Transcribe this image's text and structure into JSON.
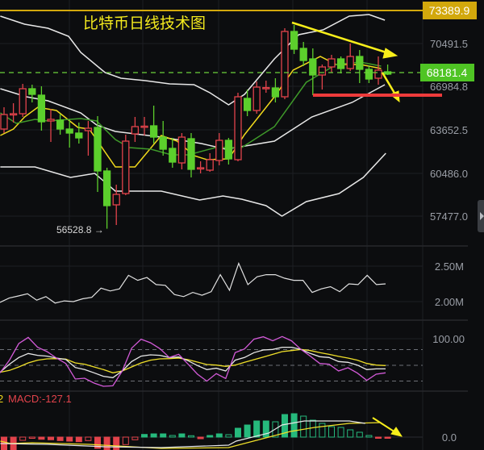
{
  "title": "比特币日线技术图",
  "chart_data": {
    "type": "candlestick",
    "title": "比特币日线技术图",
    "price_axis": {
      "labels": [
        "73389.9",
        "70491.5",
        "68181.4",
        "66984.8",
        "63652.5",
        "60486.0",
        "57477.0"
      ],
      "range": [
        56400,
        73400
      ]
    },
    "last_price": "68181.4",
    "high_line": "73389.9",
    "low_marker": "56528.8",
    "low_marker_arrow": "→",
    "candle_fields": [
      "open",
      "high",
      "low",
      "close"
    ],
    "candles": [
      [
        64043,
        65685,
        63739,
        65138
      ],
      [
        65138,
        65989,
        64530,
        65198
      ],
      [
        65198,
        67448,
        64955,
        67083
      ],
      [
        67083,
        67387,
        66050,
        66658
      ],
      [
        66597,
        67266,
        63922,
        64590
      ],
      [
        64651,
        65563,
        63070,
        64773
      ],
      [
        64712,
        65198,
        63618,
        64043
      ],
      [
        64043,
        64773,
        62645,
        63739
      ],
      [
        63739,
        64530,
        62949,
        63374
      ],
      [
        63922,
        64651,
        62037,
        64104
      ],
      [
        64165,
        65016,
        59301,
        60882
      ],
      [
        60882,
        61125,
        56528.8,
        58267
      ],
      [
        58328,
        59848,
        56808,
        59118
      ],
      [
        59179,
        63618,
        59058,
        63131
      ],
      [
        63678,
        64955,
        63070,
        64226
      ],
      [
        64226,
        64955,
        63557,
        64260
      ],
      [
        64286,
        65807,
        62949,
        63435
      ],
      [
        63435,
        64651,
        62037,
        62523
      ],
      [
        62584,
        63374,
        61125,
        61550
      ],
      [
        61490,
        63739,
        61003,
        63435
      ],
      [
        63314,
        63739,
        60395,
        61003
      ],
      [
        61064,
        61611,
        60699,
        61125
      ],
      [
        60942,
        62219,
        60821,
        61733
      ],
      [
        61672,
        63739,
        61307,
        63192
      ],
      [
        63192,
        63374,
        61368,
        61794
      ],
      [
        61733,
        66779,
        61611,
        66475
      ],
      [
        66354,
        67022,
        65016,
        65442
      ],
      [
        65442,
        67630,
        65200,
        67205
      ],
      [
        67144,
        67691,
        66779,
        67170
      ],
      [
        67144,
        67874,
        66050,
        66475
      ],
      [
        66475,
        71643,
        66293,
        71400
      ],
      [
        71400,
        71887,
        69700,
        70062
      ],
      [
        70123,
        70610,
        68786,
        69211
      ],
      [
        69333,
        70123,
        66597,
        68117
      ],
      [
        68117,
        68907,
        67022,
        68725
      ],
      [
        68725,
        69637,
        68300,
        69333
      ],
      [
        69333,
        69515,
        68239,
        68603
      ],
      [
        68603,
        70489,
        68421,
        69515
      ],
      [
        69515,
        70001,
        67509,
        68543
      ],
      [
        68543,
        68846,
        67509,
        67813
      ],
      [
        67874,
        69515,
        67387,
        68482
      ],
      [
        68360,
        68907,
        68117,
        68181.4
      ]
    ],
    "overlays": {
      "boll_upper": [
        [
          -0.4,
          72555
        ],
        [
          2.2,
          71947
        ],
        [
          4.7,
          71643
        ],
        [
          6.9,
          71035
        ],
        [
          8.2,
          69819
        ],
        [
          10.8,
          68299
        ],
        [
          12.5,
          67874
        ],
        [
          15.1,
          67691
        ],
        [
          17.7,
          67448
        ],
        [
          20.3,
          67387
        ],
        [
          22,
          66779
        ],
        [
          24,
          65867
        ],
        [
          25.7,
          66658
        ],
        [
          28.9,
          69333
        ],
        [
          31.5,
          71157
        ],
        [
          34.1,
          71522
        ],
        [
          36.9,
          72555
        ],
        [
          39,
          72677
        ],
        [
          40.7,
          72251
        ]
      ],
      "boll_mid": [
        [
          -0.4,
          67083
        ],
        [
          2.4,
          66475
        ],
        [
          4.7,
          66171
        ],
        [
          8.2,
          65259
        ],
        [
          9.9,
          64347
        ],
        [
          11.9,
          63861
        ],
        [
          16.8,
          63435
        ],
        [
          21.1,
          62949
        ],
        [
          23.7,
          62523
        ],
        [
          28.9,
          63131
        ],
        [
          32.9,
          64955
        ],
        [
          37.2,
          66050
        ],
        [
          40.7,
          67387
        ]
      ],
      "boll_lower": [
        [
          -0.4,
          61186
        ],
        [
          3.3,
          61186
        ],
        [
          7.1,
          60395
        ],
        [
          9.7,
          60699
        ],
        [
          11.9,
          59362
        ],
        [
          16.8,
          59362
        ],
        [
          20.9,
          58693
        ],
        [
          23.4,
          58997
        ],
        [
          25.4,
          58754
        ],
        [
          28,
          58267
        ],
        [
          29.7,
          57477
        ],
        [
          32.3,
          58571
        ],
        [
          35.8,
          59179
        ],
        [
          38.4,
          60395
        ],
        [
          40.8,
          62219
        ]
      ],
      "ma5": [
        [
          -0.4,
          63557
        ],
        [
          1,
          64043
        ],
        [
          2.2,
          64955
        ],
        [
          3.6,
          65685
        ],
        [
          5.6,
          65442
        ],
        [
          7.9,
          64165
        ],
        [
          9.1,
          64043
        ],
        [
          11.9,
          61186
        ],
        [
          14,
          61186
        ],
        [
          16.8,
          63557
        ],
        [
          18.5,
          63131
        ],
        [
          20.3,
          62037
        ],
        [
          21.7,
          61733
        ],
        [
          24,
          61794
        ],
        [
          25.7,
          63618
        ],
        [
          28.9,
          66475
        ],
        [
          30.9,
          68482
        ],
        [
          33.8,
          69515
        ],
        [
          35.5,
          68907
        ],
        [
          38.1,
          68907
        ],
        [
          40.3,
          68603
        ]
      ],
      "ma10": [
        [
          -0.4,
          65259
        ],
        [
          1.3,
          64469
        ],
        [
          3.3,
          64773
        ],
        [
          4.7,
          64651
        ],
        [
          8.2,
          64834
        ],
        [
          9.9,
          64651
        ],
        [
          11.9,
          63253
        ],
        [
          13.4,
          62645
        ],
        [
          15.7,
          62523
        ],
        [
          17.9,
          62098
        ],
        [
          19.7,
          62098
        ],
        [
          22.6,
          62645
        ],
        [
          25.4,
          62645
        ],
        [
          28.9,
          64226
        ],
        [
          32.3,
          67570
        ],
        [
          35.5,
          68907
        ],
        [
          38.1,
          69090
        ],
        [
          40.3,
          68786
        ]
      ]
    },
    "volume": {
      "labels": [
        "2.50M",
        "2.00M"
      ],
      "unit": "M",
      "values": [
        1.99,
        2.05,
        2.08,
        2.11,
        2.02,
        2.07,
        1.98,
        2.01,
        2.0,
        2.04,
        2.06,
        2.19,
        2.15,
        2.18,
        2.37,
        2.3,
        2.34,
        2.24,
        2.23,
        2.1,
        2.07,
        2.13,
        2.09,
        2.14,
        2.38,
        2.16,
        2.54,
        2.24,
        2.35,
        2.38,
        2.38,
        2.33,
        2.3,
        2.3,
        2.13,
        2.18,
        2.21,
        2.14,
        2.25,
        2.24,
        2.37,
        2.24,
        2.25
      ]
    },
    "kdj": {
      "label": "100.00",
      "levels": [
        80,
        50,
        20
      ],
      "j": [
        35.7,
        59.8,
        91.6,
        103.3,
        84.4,
        76.2,
        63.9,
        53.6,
        23.9,
        25.4,
        16.2,
        10.0,
        11.0,
        39.3,
        82.8,
        99.8,
        93.1,
        81.8,
        64.9,
        71.0,
        52.1,
        33.1,
        19.8,
        34.1,
        24.9,
        74.1,
        81.3,
        99.8,
        104.4,
        96.7,
        104.9,
        96.7,
        80.3,
        67.5,
        53.6,
        52.1,
        39.3,
        45.4,
        35.2,
        21.3,
        33.1,
        35.7
      ],
      "k": [
        36.7,
        52.1,
        64.9,
        72.6,
        69.0,
        67.5,
        63.9,
        61.3,
        45.9,
        41.8,
        35.7,
        29.0,
        26.4,
        39.3,
        57.2,
        67.5,
        70.0,
        69.0,
        64.9,
        65.9,
        58.7,
        49.5,
        41.8,
        44.4,
        39.3,
        59.8,
        64.9,
        74.1,
        79.3,
        80.3,
        84.4,
        84.4,
        80.3,
        72.6,
        66.4,
        64.9,
        57.2,
        55.7,
        50.5,
        41.8,
        43.3,
        43.3
      ],
      "d": [
        36.7,
        40.3,
        46.9,
        54.6,
        59.8,
        62.3,
        62.8,
        61.8,
        54.6,
        52.1,
        46.9,
        41.8,
        35.7,
        39.3,
        46.9,
        54.6,
        59.8,
        62.3,
        62.8,
        63.9,
        60.8,
        56.2,
        51.6,
        50.5,
        48.0,
        50.5,
        55.7,
        60.8,
        65.9,
        71.0,
        76.2,
        78.2,
        80.3,
        78.2,
        74.1,
        71.0,
        67.0,
        63.9,
        59.8,
        53.6,
        50.5,
        49.5
      ]
    },
    "macd": {
      "prefix": "2",
      "label": "MACD:-127.1",
      "zero_label": "0.0",
      "hist": [
        -1360,
        -1360,
        -340,
        -128,
        -230,
        -280,
        -366,
        -425,
        -485,
        -366,
        -1190,
        -1360,
        -1360,
        -790,
        -280,
        280,
        340,
        340,
        170,
        340,
        145,
        -170,
        170,
        340,
        255,
        935,
        1275,
        1700,
        1700,
        1615,
        2380,
        2465,
        2210,
        1785,
        1445,
        1105,
        1020,
        765,
        510,
        170,
        -85,
        -127.1
      ],
      "dif": [
        [
          -0.4,
          -680
        ],
        [
          4.7,
          -765
        ],
        [
          10.8,
          -1020
        ],
        [
          16.8,
          -1105
        ],
        [
          24,
          -850
        ],
        [
          24.8,
          -425
        ],
        [
          28.3,
          425
        ],
        [
          29.7,
          1275
        ],
        [
          32.1,
          1700
        ],
        [
          36.9,
          1700
        ],
        [
          38.6,
          1445
        ]
      ],
      "dea": [
        [
          -0.4,
          -425
        ],
        [
          0.7,
          -680
        ],
        [
          3,
          -595
        ],
        [
          9.1,
          -765
        ],
        [
          16.8,
          -1190
        ],
        [
          24,
          -1105
        ],
        [
          28.3,
          0
        ],
        [
          30.6,
          595
        ],
        [
          33.2,
          1020
        ],
        [
          36.9,
          1445
        ],
        [
          40.3,
          1530
        ]
      ]
    },
    "colors": {
      "up": "#e2434b",
      "down": "#5ccf2c",
      "macd_up": "#26b97c",
      "macd_down": "#e2434b",
      "ma5": "#f0d81c",
      "ma10": "#3f9a2a",
      "boll": "#e8e8e8",
      "k": "#e8e8e8",
      "d": "#f0e02a",
      "j": "#d35ad8",
      "high_line": "#d2a80c",
      "last_price": "#4fc424",
      "support_line": "#ee3b3b",
      "annotation": "#f7ee1a"
    }
  }
}
